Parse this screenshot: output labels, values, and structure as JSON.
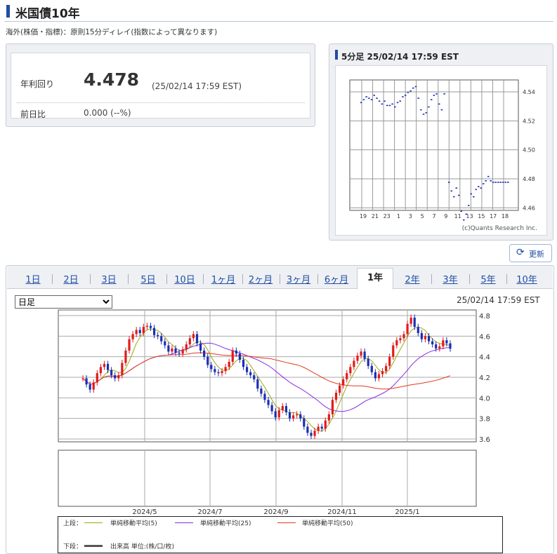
{
  "header": {
    "title": "米国債10年",
    "note": "海外(株価・指標)：原則15分ディレイ(指数によって異なります)"
  },
  "quote": {
    "yield_label": "年利回り",
    "yield_value": "4.478",
    "yield_time": "(25/02/14 17:59 EST)",
    "change_label": "前日比",
    "change_value": "0.000 (--%)"
  },
  "intraday": {
    "title": "5分足 25/02/14 17:59 EST",
    "y_ticks": [
      "4.54",
      "4.52",
      "4.50",
      "4.48",
      "4.46"
    ],
    "x_ticks": [
      "19",
      "21",
      "23",
      "1",
      "3",
      "5",
      "7",
      "9",
      "11",
      "13",
      "15",
      "17",
      "18"
    ],
    "credit": "(c)Quants Research Inc.",
    "series_up": [
      4.533,
      4.535,
      4.537,
      4.536,
      4.535,
      4.538,
      4.536,
      4.534,
      4.532,
      4.534,
      4.531,
      4.531,
      4.532,
      4.53,
      4.533,
      4.534,
      4.537,
      4.538,
      4.54,
      4.541,
      4.543,
      4.544,
      4.536,
      4.528,
      4.525,
      4.526,
      4.53,
      4.535,
      4.538,
      4.539,
      4.532,
      4.528,
      4.539
    ],
    "series_down": [
      4.478,
      4.472,
      4.468,
      4.474,
      4.469,
      4.458,
      4.452,
      4.456,
      4.462,
      4.47,
      4.468,
      4.473,
      4.475,
      4.474,
      4.477,
      4.479,
      4.482,
      4.479,
      4.478,
      4.478,
      4.478,
      4.478,
      4.478,
      4.478,
      4.478
    ]
  },
  "refresh": {
    "label": "更新"
  },
  "tabs": [
    "1日",
    "2日",
    "3日",
    "5日",
    "10日",
    "1ヶ月",
    "2ヶ月",
    "3ヶ月",
    "6ヶ月",
    "1年",
    "2年",
    "3年",
    "5年",
    "10年"
  ],
  "active_tab": "1年",
  "period_select": {
    "selected": "日足"
  },
  "chart_time": "25/02/14 17:59 EST",
  "chart_data": {
    "type": "candlestick",
    "y_ticks": [
      3.6,
      3.8,
      4.0,
      4.2,
      4.4,
      4.6,
      4.8
    ],
    "ylim": [
      3.6,
      4.8
    ],
    "x_ticks": [
      "2024/5",
      "2024/7",
      "2024/9",
      "2024/11",
      "2025/1"
    ],
    "closes": [
      4.19,
      4.13,
      4.08,
      4.15,
      4.24,
      4.3,
      4.33,
      4.27,
      4.22,
      4.19,
      4.22,
      4.34,
      4.46,
      4.57,
      4.62,
      4.66,
      4.63,
      4.69,
      4.7,
      4.68,
      4.61,
      4.6,
      4.55,
      4.51,
      4.45,
      4.48,
      4.44,
      4.43,
      4.47,
      4.52,
      4.58,
      4.62,
      4.53,
      4.46,
      4.4,
      4.32,
      4.28,
      4.25,
      4.24,
      4.26,
      4.3,
      4.35,
      4.46,
      4.43,
      4.37,
      4.3,
      4.25,
      4.22,
      4.18,
      4.09,
      4.04,
      3.98,
      3.93,
      3.87,
      3.81,
      3.88,
      3.92,
      3.86,
      3.8,
      3.83,
      3.84,
      3.8,
      3.72,
      3.66,
      3.63,
      3.68,
      3.72,
      3.7,
      3.78,
      3.84,
      3.98,
      4.05,
      4.12,
      4.18,
      4.24,
      4.3,
      4.36,
      4.41,
      4.45,
      4.38,
      4.31,
      4.25,
      4.19,
      4.23,
      4.26,
      4.31,
      4.4,
      4.51,
      4.56,
      4.58,
      4.62,
      4.72,
      4.78,
      4.69,
      4.63,
      4.57,
      4.6,
      4.55,
      4.52,
      4.48,
      4.5,
      4.56,
      4.53,
      4.478
    ],
    "legend_top": {
      "label": "上段：",
      "items": [
        {
          "name": "単純移動平均(5)",
          "color": "#9aaa12"
        },
        {
          "name": "単純移動平均(25)",
          "color": "#8a2be2"
        },
        {
          "name": "単純移動平均(50)",
          "color": "#e23b1e"
        }
      ]
    },
    "legend_bottom": {
      "label": "下段：",
      "item": "出来高 単位:(株/口/枚)"
    },
    "colors": {
      "up": "#e21b1b",
      "down": "#1b2fb4",
      "grid": "#9aa",
      "frame": "#555"
    }
  }
}
